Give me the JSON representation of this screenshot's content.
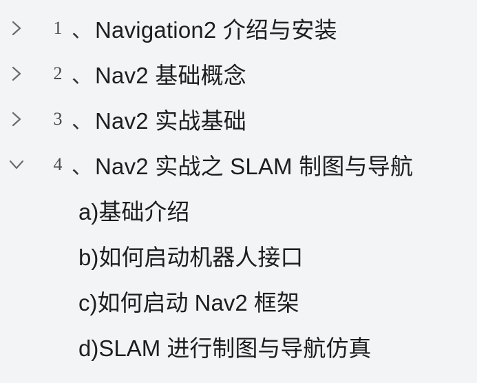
{
  "outline": {
    "sections": [
      {
        "number": "1",
        "separator": "、",
        "title": "Navigation2 介绍与安装",
        "expanded": false,
        "icon": "chevron-right-icon"
      },
      {
        "number": "2",
        "separator": "、",
        "title": "Nav2 基础概念",
        "expanded": false,
        "icon": "chevron-right-icon"
      },
      {
        "number": "3",
        "separator": "、",
        "title": "Nav2 实战基础",
        "expanded": false,
        "icon": "chevron-right-icon"
      },
      {
        "number": "4",
        "separator": "、",
        "title": "Nav2 实战之 SLAM 制图与导航",
        "expanded": true,
        "icon": "chevron-down-icon"
      }
    ],
    "subitems": [
      {
        "label": "a)基础介绍"
      },
      {
        "label": "b)如何启动机器人接口"
      },
      {
        "label": "c)如何启动 Nav2 框架"
      },
      {
        "label": "d)SLAM 进行制图与导航仿真"
      }
    ]
  },
  "colors": {
    "background": "#f3f4f6",
    "text": "#1e1e1e",
    "chevron": "#6b6b6b"
  }
}
